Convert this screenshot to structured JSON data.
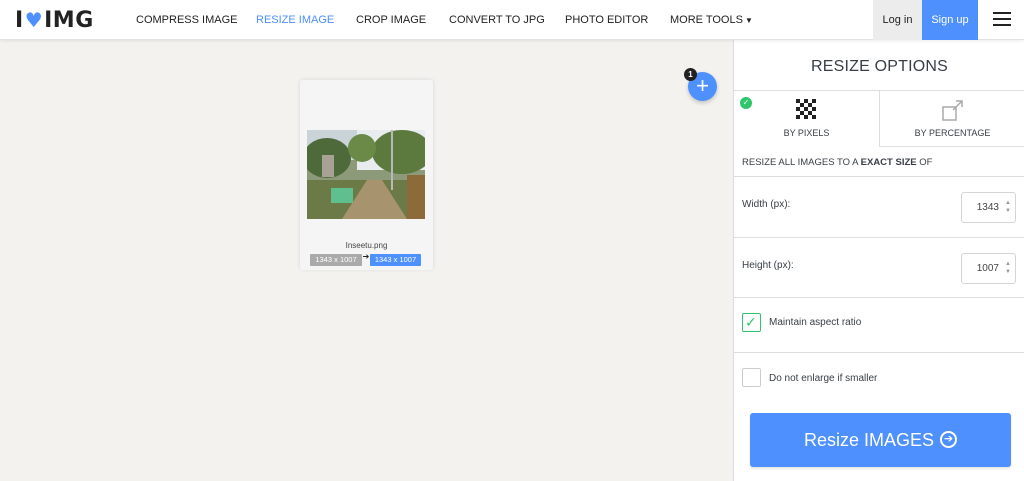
{
  "header": {
    "logo": {
      "left": "I",
      "right": "IMG"
    },
    "nav": [
      {
        "label": "COMPRESS IMAGE"
      },
      {
        "label": "RESIZE IMAGE"
      },
      {
        "label": "CROP IMAGE"
      },
      {
        "label": "CONVERT TO JPG"
      },
      {
        "label": "PHOTO EDITOR"
      },
      {
        "label": "MORE TOOLS"
      }
    ],
    "login": "Log in",
    "signup": "Sign up"
  },
  "workspace": {
    "file": {
      "name": "Inseetu.png",
      "original_size": "1343 x 1007",
      "new_size": "1343 x 1007"
    },
    "add_badge": "1"
  },
  "sidebar": {
    "title": "RESIZE OPTIONS",
    "tabs": [
      {
        "label": "BY PIXELS",
        "icon": "pixels-icon",
        "selected": true
      },
      {
        "label": "BY PERCENTAGE",
        "icon": "percentage-icon",
        "selected": false
      }
    ],
    "desc": {
      "prefix": "RESIZE ALL IMAGES TO A",
      "bold": "EXACT SIZE",
      "suffix": "OF"
    },
    "width": {
      "label": "Width (px):",
      "value": "1343"
    },
    "height": {
      "label": "Height (px):",
      "value": "1007"
    },
    "maintain_aspect": {
      "label": "Maintain aspect ratio",
      "checked": true
    },
    "no_enlarge": {
      "label": "Do not enlarge if smaller",
      "checked": false
    },
    "button": "Resize IMAGES"
  },
  "colors": {
    "accent": "#4d90fe",
    "check": "#2ec66b",
    "workspace_bg": "#f3f2ef"
  }
}
